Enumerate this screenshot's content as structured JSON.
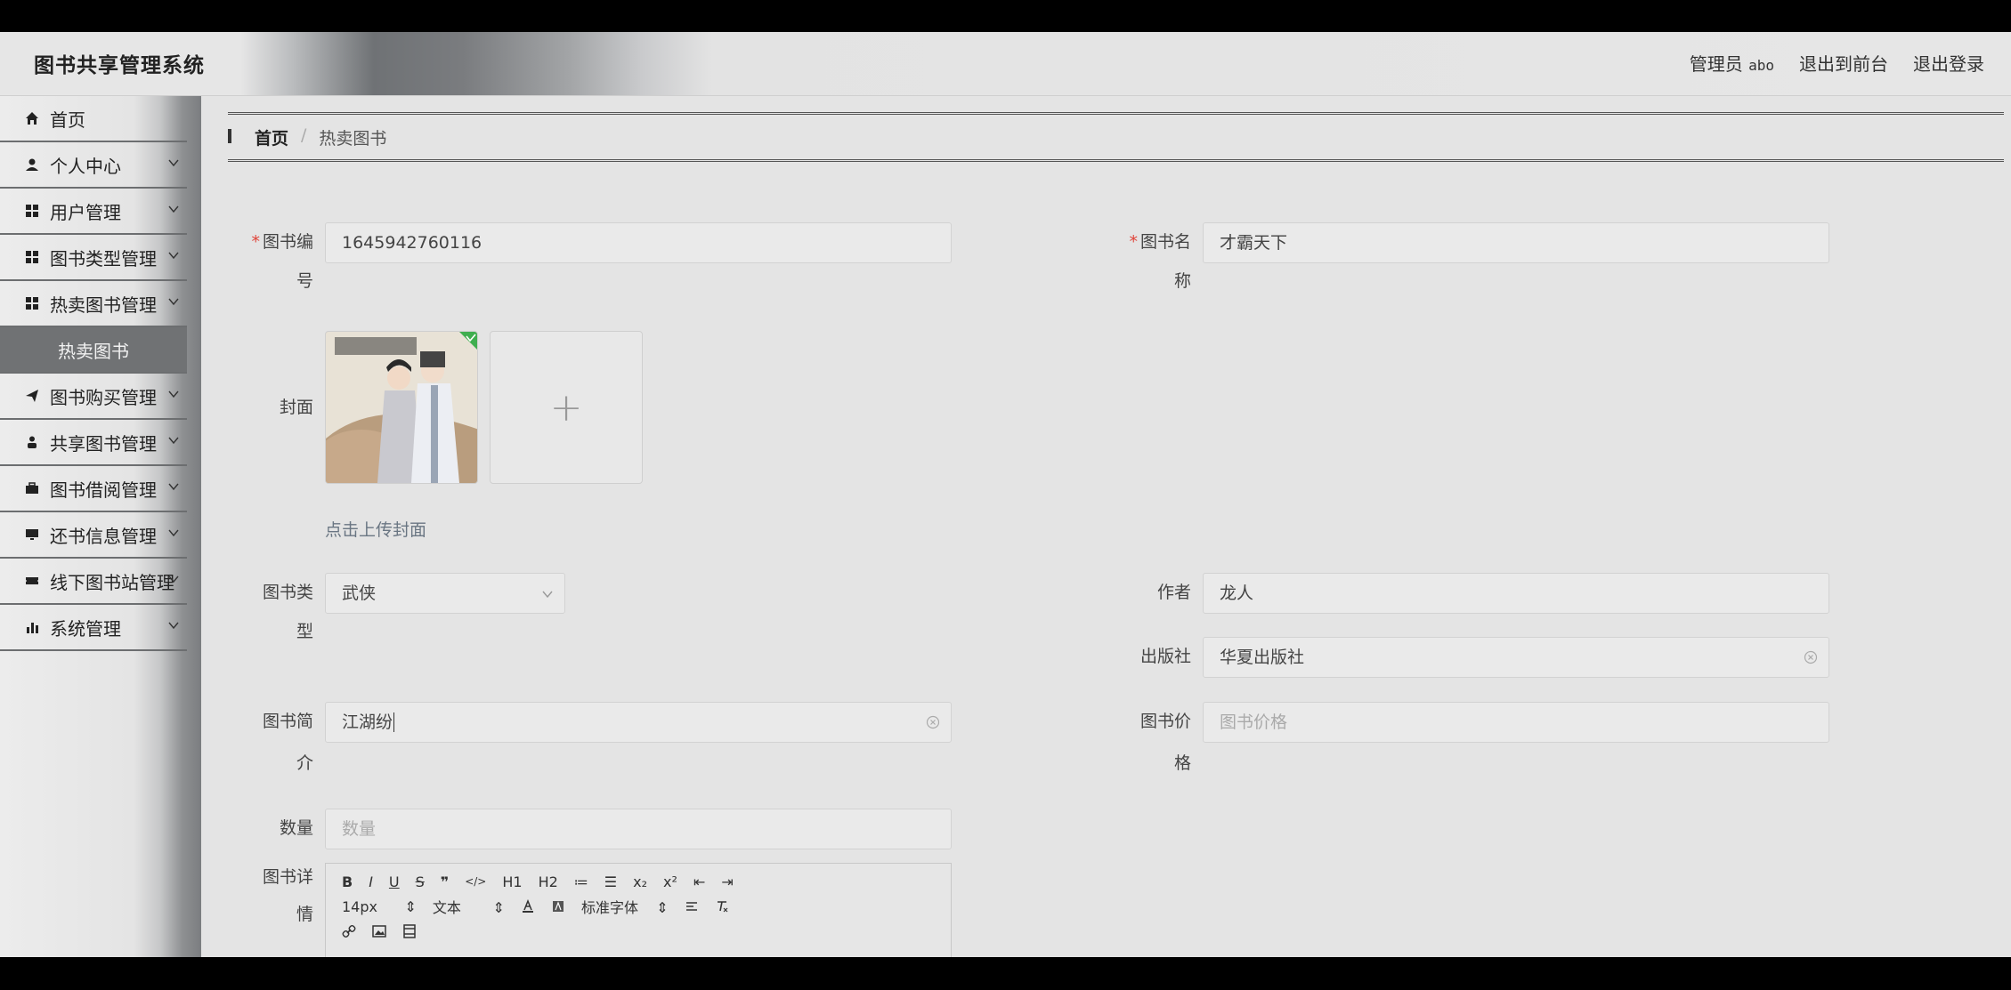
{
  "app": {
    "title": "图书共享管理系统"
  },
  "topbar": {
    "role": "管理员",
    "user": "abo",
    "to_front": "退出到前台",
    "logout": "退出登录"
  },
  "sidebar": {
    "items": [
      {
        "label": "首页",
        "icon": "home-icon"
      },
      {
        "label": "个人中心",
        "icon": "user-icon"
      },
      {
        "label": "用户管理",
        "icon": "grid-icon"
      },
      {
        "label": "图书类型管理",
        "icon": "grid-icon"
      },
      {
        "label": "热卖图书管理",
        "icon": "grid-icon"
      },
      {
        "label": "热卖图书",
        "icon": ""
      },
      {
        "label": "图书购买管理",
        "icon": "send-icon"
      },
      {
        "label": "共享图书管理",
        "icon": "person-icon"
      },
      {
        "label": "图书借阅管理",
        "icon": "briefcase-icon"
      },
      {
        "label": "还书信息管理",
        "icon": "monitor-icon"
      },
      {
        "label": "线下图书站管理",
        "icon": "ticket-icon"
      },
      {
        "label": "系统管理",
        "icon": "bar-chart-icon"
      }
    ]
  },
  "breadcrumb": {
    "home": "首页",
    "sep": "/",
    "current": "热卖图书"
  },
  "form": {
    "book_no": {
      "label1": "图书编",
      "label2": "号",
      "required": "*",
      "value": "1645942760116"
    },
    "book_name": {
      "label1": "图书名",
      "label2": "称",
      "required": "*",
      "value": "才霸天下"
    },
    "cover": {
      "label": "封面",
      "hint": "点击上传封面",
      "plus": "+"
    },
    "book_type": {
      "label1": "图书类",
      "label2": "型",
      "value": "武侠"
    },
    "author": {
      "label": "作者",
      "value": "龙人"
    },
    "publisher": {
      "label": "出版社",
      "value": "华夏出版社"
    },
    "summary": {
      "label1": "图书简",
      "label2": "介",
      "value": "江湖纷"
    },
    "price": {
      "label1": "图书价",
      "label2": "格",
      "placeholder": "图书价格"
    },
    "quantity": {
      "label": "数量",
      "placeholder": "数量"
    },
    "detail": {
      "label1": "图书详",
      "label2": "情"
    }
  },
  "editor": {
    "row1": [
      "B",
      "I",
      "U",
      "S",
      "❞",
      "</>",
      "H1",
      "H2",
      "≔",
      "☰",
      "x₂",
      "x²",
      "⇤",
      "⇥"
    ],
    "font_size": "14px",
    "block": "文本",
    "font": "标准字体",
    "updown": "⇕"
  },
  "colors": {
    "required": "#e0443a",
    "hint": "#6a7683",
    "active_nav": "#707274"
  }
}
